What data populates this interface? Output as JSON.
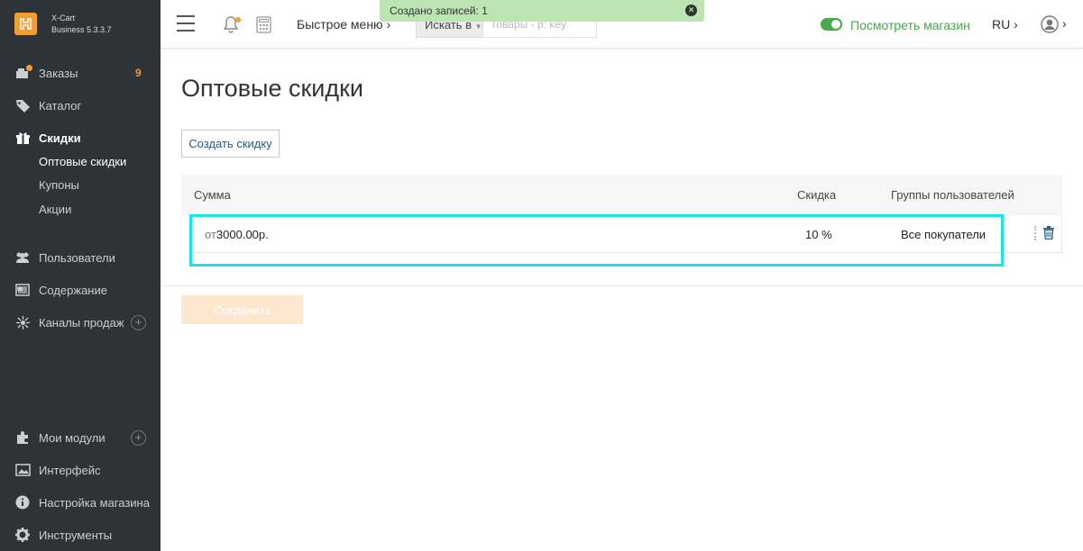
{
  "brand": {
    "line1": "X-Cart",
    "line2": "Business 5.3.3.7"
  },
  "sidebar": {
    "items": [
      {
        "label": "Заказы",
        "badge": "9",
        "icon": "orders-icon"
      },
      {
        "label": "Каталог",
        "icon": "tag-icon"
      },
      {
        "label": "Скидки",
        "icon": "gift-icon"
      },
      {
        "label": "Пользователи",
        "icon": "users-icon"
      },
      {
        "label": "Содержание",
        "icon": "content-icon"
      },
      {
        "label": "Каналы продаж",
        "icon": "sales-channels-icon"
      },
      {
        "label": "Мои модули",
        "icon": "puzzle-icon"
      },
      {
        "label": "Интерфейс",
        "icon": "image-icon"
      },
      {
        "label": "Настройка магазина",
        "icon": "info-icon"
      },
      {
        "label": "Инструменты",
        "icon": "gear-icon"
      }
    ],
    "discount_sub": [
      "Оптовые скидки",
      "Купоны",
      "Акции"
    ]
  },
  "header": {
    "quick_menu": "Быстрое меню",
    "search_select": "Искать в",
    "search_placeholder": "Товары - р: key",
    "view_store": "Посмотреть магазин",
    "lang": "RU"
  },
  "flash": {
    "message": "Создано записей: 1",
    "close": "×"
  },
  "main": {
    "title": "Оптовые скидки",
    "create_button": "Создать скидку",
    "columns": {
      "sum": "Сумма",
      "discount": "Скидка",
      "groups": "Группы пользователей"
    },
    "rows": [
      {
        "prefix": "от",
        "amount": "3000.00",
        "currency": "р.",
        "discount": "10 %",
        "groups": "Все покупатели"
      }
    ],
    "save_button": "Сохранить"
  },
  "colors": {
    "sidebar": "#2c3439",
    "accent": "#f39c30",
    "green": "#48a84b",
    "highlight": "#19e3e6"
  }
}
